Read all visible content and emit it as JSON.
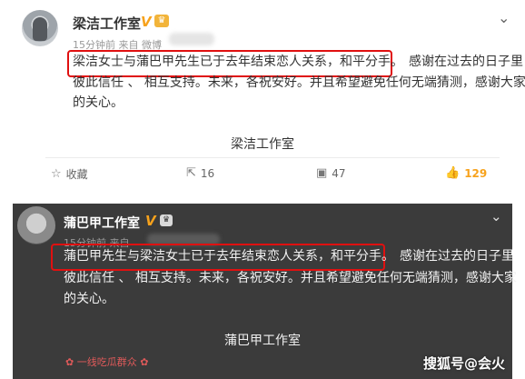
{
  "post1": {
    "author": "梁洁工作室",
    "vip_badge": "V",
    "meta_time": "15分钟前 来自 微博",
    "line1_highlight": "梁洁女士与蒲巴甲先生已于去年结束恋人关系，和平分手。",
    "line1_rest": "感谢在过去的日子里",
    "line2": "彼此信任 、 相互支持。未来，各祝安好。并且希望避免任何无端猜测，感谢大家",
    "line3": "的关心。",
    "signature": "梁洁工作室",
    "actions": {
      "favorite_label": "收藏",
      "repost_count": "16",
      "comment_count": "47",
      "like_count": "129"
    }
  },
  "post2": {
    "author": "蒲巴甲工作室",
    "vip_badge": "V",
    "meta_time": "15分钟前 来自",
    "line1_highlight": "蒲巴甲先生与梁洁女士已于去年结束恋人关系，和平分手。",
    "line1_rest": "感谢在过去的日子里",
    "line2": "彼此信任 、 相互支持。未来，各祝安好。并且希望避免任何无端猜测，感谢大家",
    "line3": "的关心。",
    "signature": "蒲巴甲工作室",
    "fan_group": "一线吃瓜群众"
  },
  "watermark": "搜狐号@会火",
  "colors": {
    "highlight_box": "#e01010",
    "like_accent": "#f7a21c",
    "dark_card_bg": "#3b3b3b"
  }
}
